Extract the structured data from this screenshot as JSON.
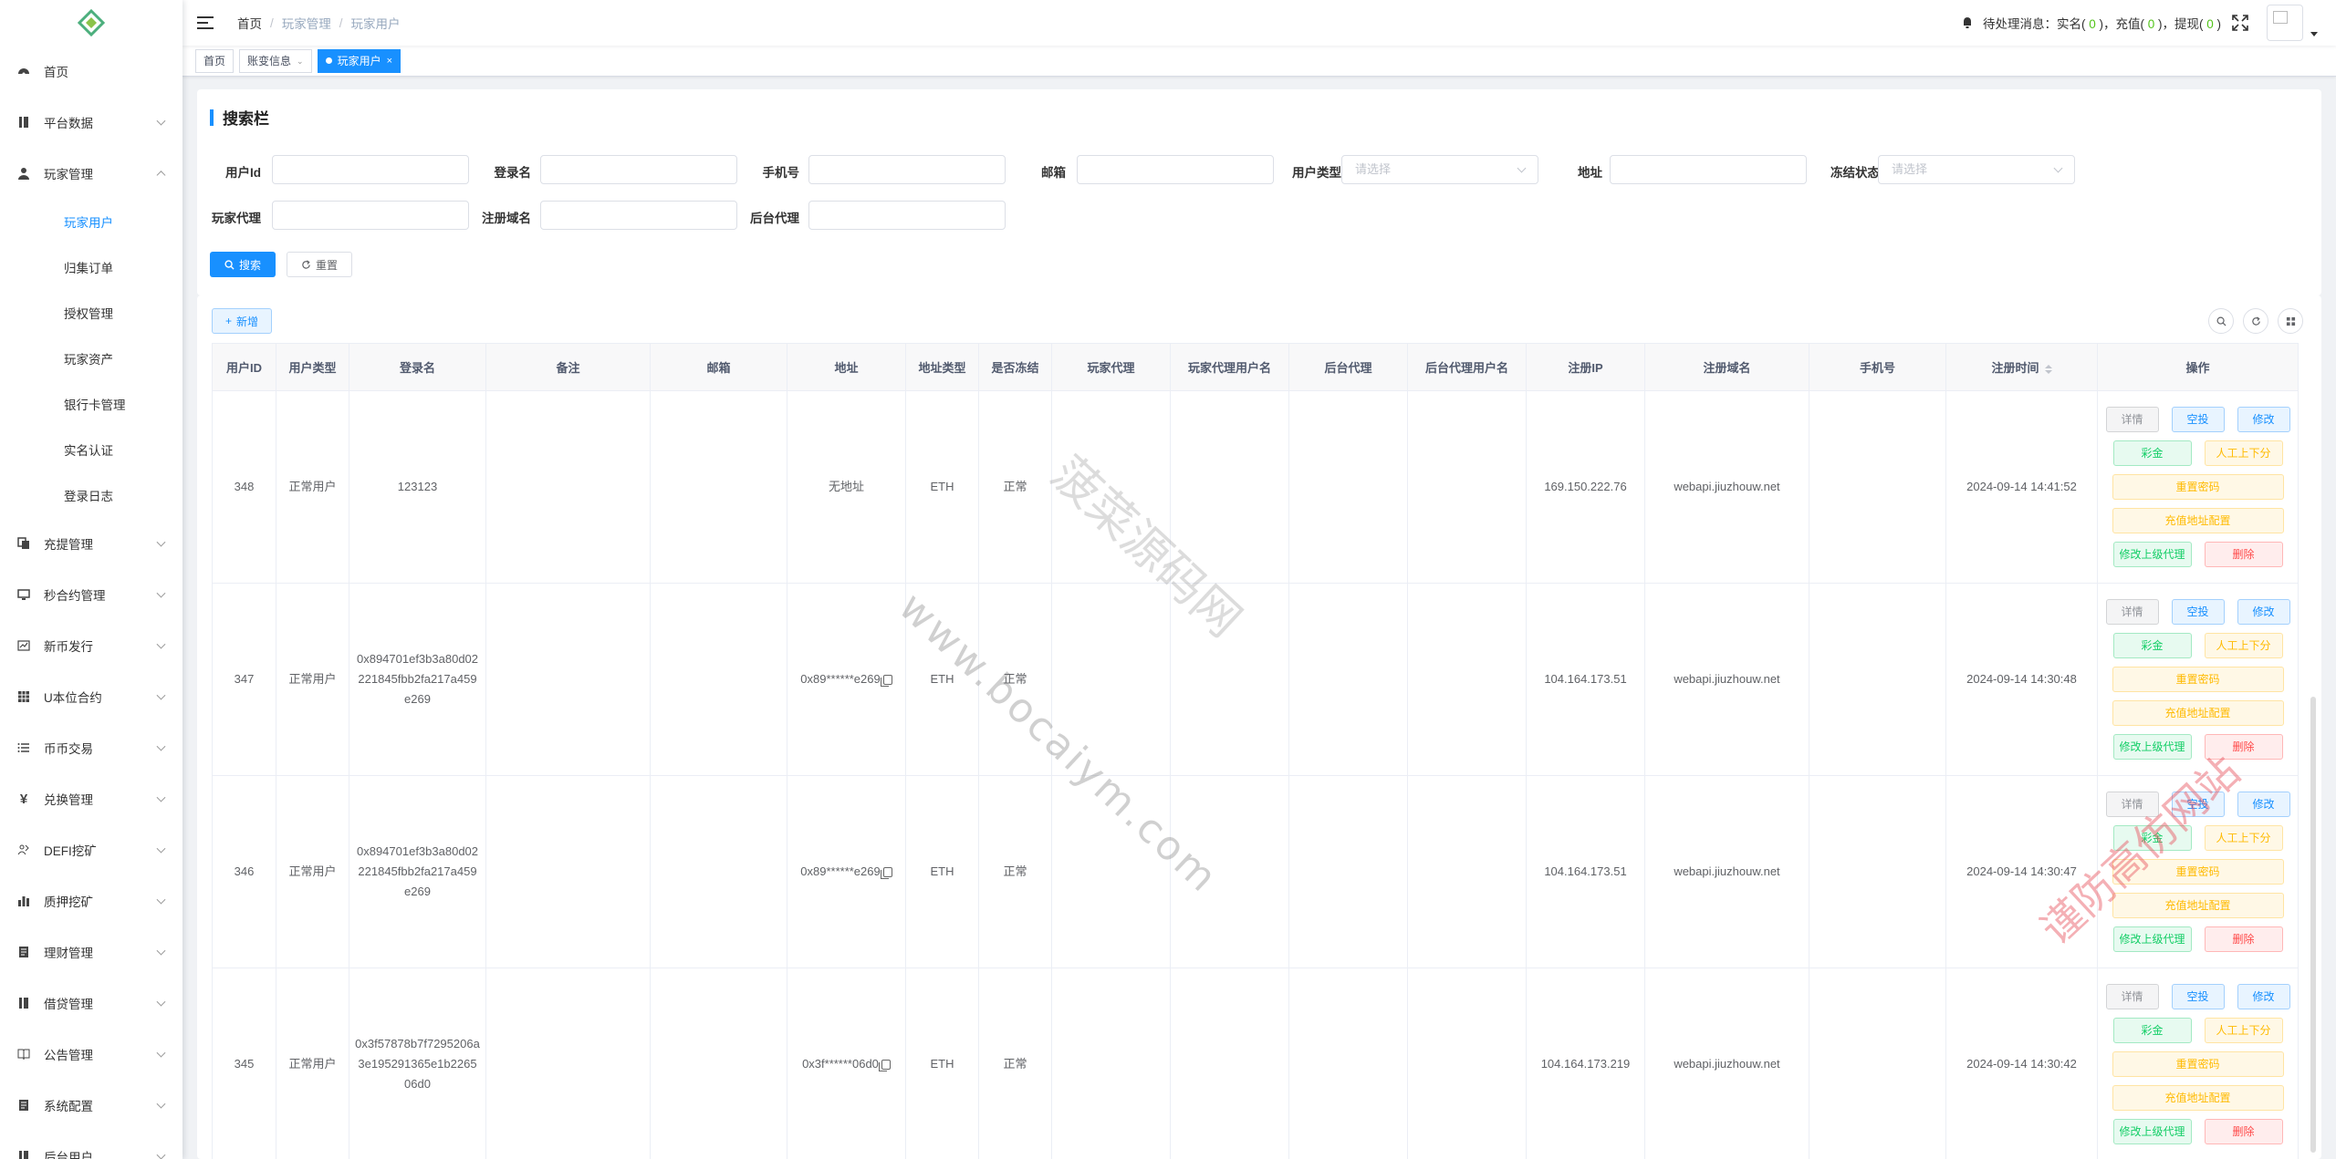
{
  "sidebar": {
    "menu": [
      {
        "label": "首页",
        "icon": "dashboard-icon"
      },
      {
        "label": "平台数据",
        "icon": "book-icon"
      },
      {
        "label": "玩家管理",
        "icon": "user-icon"
      },
      {
        "label": "充提管理",
        "icon": "copy-icon"
      },
      {
        "label": "秒合约管理",
        "icon": "monitor-icon"
      },
      {
        "label": "新币发行",
        "icon": "chart-icon"
      },
      {
        "label": "U本位合约",
        "icon": "grid-icon"
      },
      {
        "label": "币币交易",
        "icon": "list-icon"
      },
      {
        "label": "兑换管理",
        "icon": "yen-icon"
      },
      {
        "label": "DEFI挖矿",
        "icon": "people-icon"
      },
      {
        "label": "质押挖矿",
        "icon": "bar-chart-icon"
      },
      {
        "label": "理财管理",
        "icon": "file-icon"
      },
      {
        "label": "借贷管理",
        "icon": "book-icon"
      },
      {
        "label": "公告管理",
        "icon": "open-book-icon"
      },
      {
        "label": "系统配置",
        "icon": "file-icon"
      },
      {
        "label": "后台用户",
        "icon": "book-icon"
      }
    ],
    "submenu": [
      "玩家用户",
      "归集订单",
      "授权管理",
      "玩家资产",
      "银行卡管理",
      "实名认证",
      "登录日志"
    ]
  },
  "navbar": {
    "breadcrumb": [
      "首页",
      "玩家管理",
      "玩家用户"
    ],
    "notice_prefix": "待处理消息：",
    "notice_items": [
      {
        "label": "实名",
        "count": "0"
      },
      {
        "label": "充值",
        "count": "0"
      },
      {
        "label": "提现",
        "count": "0"
      }
    ]
  },
  "tags": [
    {
      "label": "首页"
    },
    {
      "label": "账变信息"
    },
    {
      "label": "玩家用户"
    }
  ],
  "search": {
    "title": "搜索栏",
    "labels": {
      "user_id": "用户Id",
      "login": "登录名",
      "phone": "手机号",
      "email": "邮箱",
      "user_type": "用户类型",
      "address": "地址",
      "frozen": "冻结状态",
      "agent": "玩家代理",
      "domain": "注册域名",
      "backend_agent": "后台代理"
    },
    "placeholder_select": "请选择",
    "search_btn": "搜索",
    "reset_btn": "重置"
  },
  "table": {
    "add_btn": "新增",
    "columns": [
      "用户ID",
      "用户类型",
      "登录名",
      "备注",
      "邮箱",
      "地址",
      "地址类型",
      "是否冻结",
      "玩家代理",
      "玩家代理用户名",
      "后台代理",
      "后台代理用户名",
      "注册IP",
      "注册域名",
      "手机号",
      "注册时间",
      "操作"
    ],
    "rows": [
      {
        "id": "348",
        "type": "正常用户",
        "login": "123123",
        "note": "",
        "email": "",
        "address": "无地址",
        "addr_type": "ETH",
        "frozen": "正常",
        "agent": "",
        "agent_name": "",
        "backend_agent": "",
        "backend_agent_name": "",
        "ip": "169.150.222.76",
        "domain": "webapi.jiuzhouw.net",
        "phone": "",
        "time": "2024-09-14 14:41:52"
      },
      {
        "id": "347",
        "type": "正常用户",
        "login": "0x894701ef3b3a80d02221845fbb2fa217a459e269",
        "note": "",
        "email": "",
        "address": "0x89******e269",
        "addr_type": "ETH",
        "frozen": "正常",
        "agent": "",
        "agent_name": "",
        "backend_agent": "",
        "backend_agent_name": "",
        "ip": "104.164.173.51",
        "domain": "webapi.jiuzhouw.net",
        "phone": "",
        "time": "2024-09-14 14:30:48"
      },
      {
        "id": "346",
        "type": "正常用户",
        "login": "0x894701ef3b3a80d02221845fbb2fa217a459e269",
        "note": "",
        "email": "",
        "address": "0x89******e269",
        "addr_type": "ETH",
        "frozen": "正常",
        "agent": "",
        "agent_name": "",
        "backend_agent": "",
        "backend_agent_name": "",
        "ip": "104.164.173.51",
        "domain": "webapi.jiuzhouw.net",
        "phone": "",
        "time": "2024-09-14 14:30:47"
      },
      {
        "id": "345",
        "type": "正常用户",
        "login": "0x3f57878b7f7295206a3e195291365e1b226506d0",
        "note": "",
        "email": "",
        "address": "0x3f******06d0",
        "addr_type": "ETH",
        "frozen": "正常",
        "agent": "",
        "agent_name": "",
        "backend_agent": "",
        "backend_agent_name": "",
        "ip": "104.164.173.219",
        "domain": "webapi.jiuzhouw.net",
        "phone": "",
        "time": "2024-09-14 14:30:42"
      }
    ],
    "ops": {
      "detail": "详情",
      "airdrop": "空投",
      "edit": "修改",
      "bonus": "彩金",
      "manual": "人工上下分",
      "reset_pwd": "重置密码",
      "recharge_addr": "充值地址配置",
      "edit_agent": "修改上级代理",
      "delete": "删除"
    }
  },
  "watermarks": {
    "url": "www.bocaiym.com",
    "brand": "菠菜源码网",
    "slogan": "谨防高仿网站"
  },
  "colors": {
    "primary": "#1890ff",
    "success": "#13ce66",
    "warning": "#ffba00",
    "danger": "#ff4949",
    "notice_count": "#52c41a"
  }
}
